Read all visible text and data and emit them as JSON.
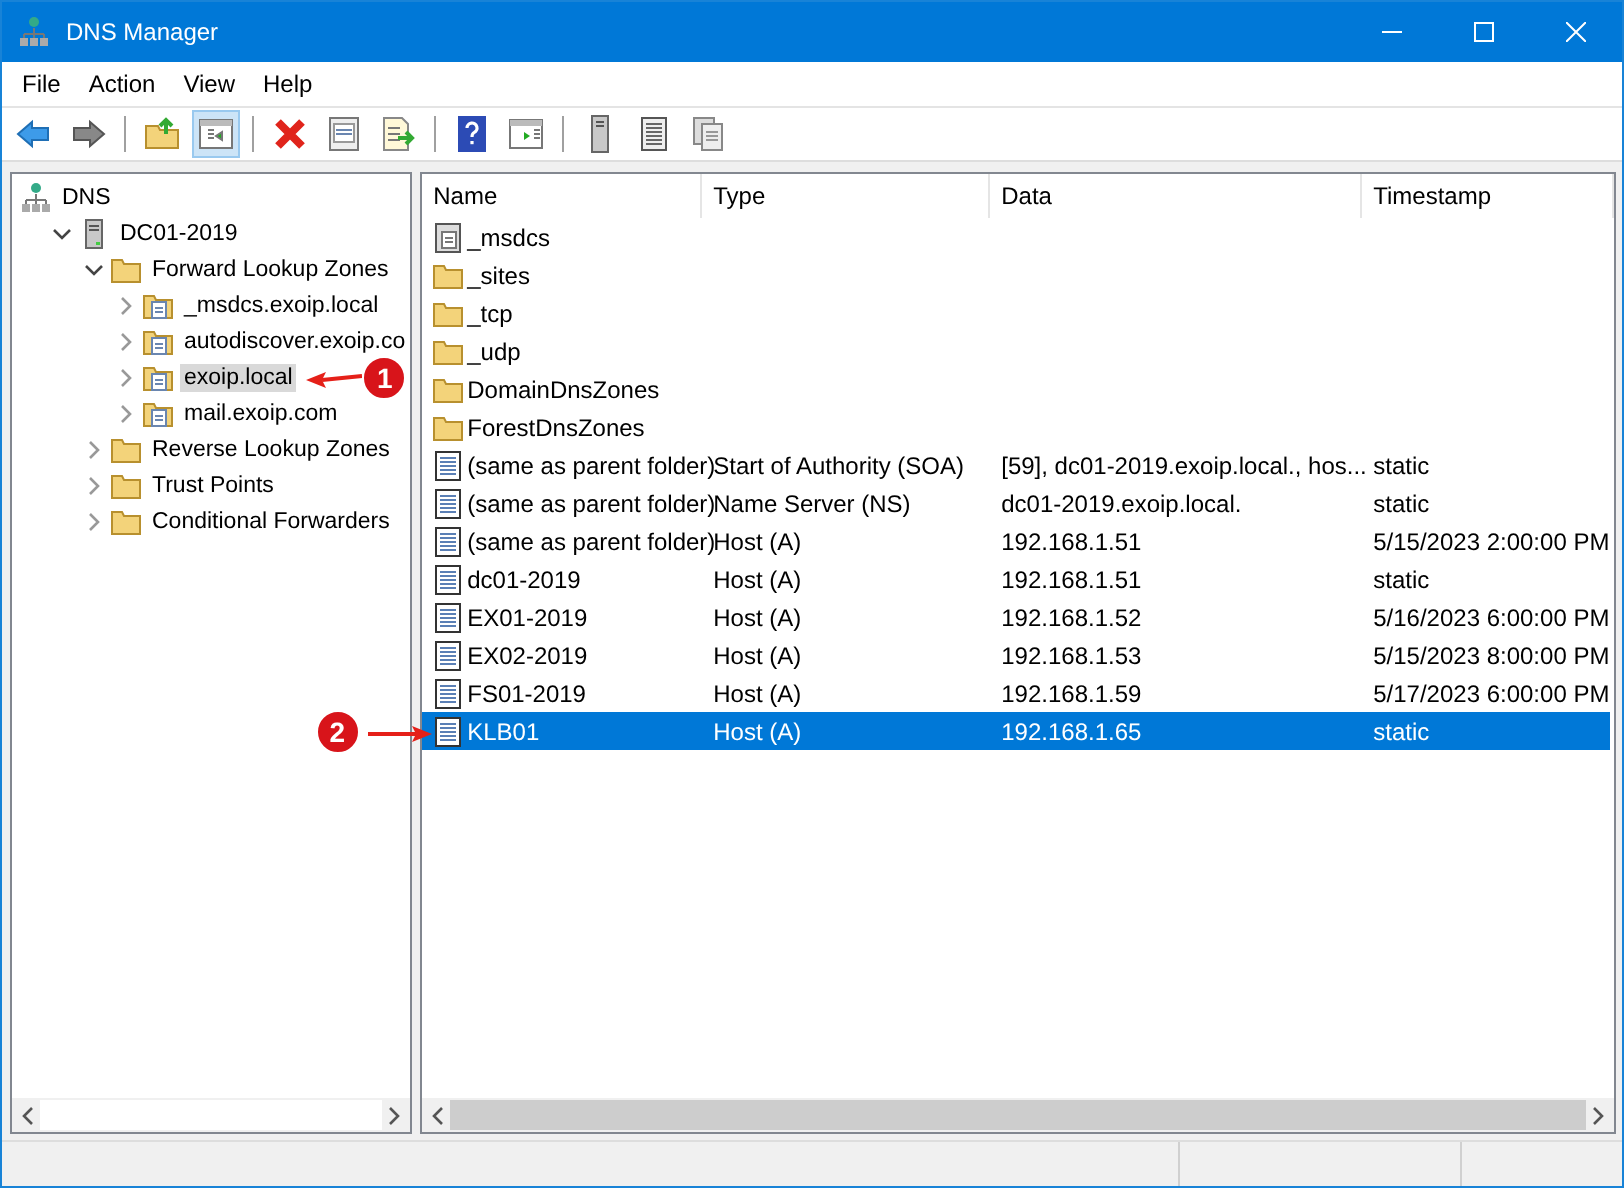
{
  "window": {
    "title": "DNS Manager"
  },
  "menu": [
    {
      "label": "File"
    },
    {
      "label": "Action"
    },
    {
      "label": "View"
    },
    {
      "label": "Help"
    }
  ],
  "toolbar": [
    {
      "pressed": false
    },
    {
      "pressed": false
    },
    {
      "pressed": false
    },
    {
      "pressed": true
    },
    {
      "pressed": false
    },
    {
      "pressed": false
    },
    {
      "pressed": false
    },
    {
      "pressed": false
    },
    {
      "pressed": false
    },
    {
      "pressed": false
    },
    {
      "pressed": false
    },
    {
      "pressed": false
    }
  ],
  "tree": [
    {
      "label": "DNS",
      "kind": "dns",
      "selected": false,
      "children": [
        {
          "label": "DC01-2019",
          "kind": "server",
          "expanded": true,
          "selected": false,
          "children": [
            {
              "label": "Forward Lookup Zones",
              "kind": "folder",
              "expanded": true,
              "selected": false,
              "children": [
                {
                  "label": "_msdcs.exoip.local",
                  "kind": "zone",
                  "expanded": false,
                  "selected": false
                },
                {
                  "label": "autodiscover.exoip.co",
                  "kind": "zone",
                  "expanded": false,
                  "selected": false
                },
                {
                  "label": "exoip.local",
                  "kind": "zone",
                  "expanded": false,
                  "selected": true,
                  "callout": "1"
                },
                {
                  "label": "mail.exoip.com",
                  "kind": "zone",
                  "expanded": false,
                  "selected": false
                }
              ]
            },
            {
              "label": "Reverse Lookup Zones",
              "kind": "folder",
              "expanded": false,
              "selected": false
            },
            {
              "label": "Trust Points",
              "kind": "folder",
              "expanded": false,
              "selected": false
            },
            {
              "label": "Conditional Forwarders",
              "kind": "folder",
              "expanded": false,
              "selected": false
            }
          ]
        }
      ]
    }
  ],
  "table": {
    "columns": [
      "Name",
      "Type",
      "Data",
      "Timestamp"
    ],
    "rows": [
      {
        "kind": "delegation",
        "name": "_msdcs",
        "selected": false
      },
      {
        "kind": "folder",
        "name": "_sites",
        "selected": false
      },
      {
        "kind": "folder",
        "name": "_tcp",
        "selected": false
      },
      {
        "kind": "folder",
        "name": "_udp",
        "selected": false
      },
      {
        "kind": "folder",
        "name": "DomainDnsZones",
        "selected": false
      },
      {
        "kind": "folder",
        "name": "ForestDnsZones",
        "selected": false
      },
      {
        "kind": "record",
        "name": "(same as parent folder)",
        "type": "Start of Authority (SOA)",
        "data": "[59], dc01-2019.exoip.local., hos...",
        "timestamp": "static",
        "selected": false
      },
      {
        "kind": "record",
        "name": "(same as parent folder)",
        "type": "Name Server (NS)",
        "data": "dc01-2019.exoip.local.",
        "timestamp": "static",
        "selected": false
      },
      {
        "kind": "record",
        "name": "(same as parent folder)",
        "type": "Host (A)",
        "data": "192.168.1.51",
        "timestamp": "5/15/2023 2:00:00 PM",
        "selected": false
      },
      {
        "kind": "record",
        "name": "dc01-2019",
        "type": "Host (A)",
        "data": "192.168.1.51",
        "timestamp": "static",
        "selected": false
      },
      {
        "kind": "record",
        "name": "EX01-2019",
        "type": "Host (A)",
        "data": "192.168.1.52",
        "timestamp": "5/16/2023 6:00:00 PM",
        "selected": false
      },
      {
        "kind": "record",
        "name": "EX02-2019",
        "type": "Host (A)",
        "data": "192.168.1.53",
        "timestamp": "5/15/2023 8:00:00 PM",
        "selected": false
      },
      {
        "kind": "record",
        "name": "FS01-2019",
        "type": "Host (A)",
        "data": "192.168.1.59",
        "timestamp": "5/17/2023 6:00:00 PM",
        "selected": false
      },
      {
        "kind": "record",
        "name": "KLB01",
        "type": "Host (A)",
        "data": "192.168.1.65",
        "timestamp": "static",
        "selected": true,
        "callout": "2"
      }
    ]
  }
}
